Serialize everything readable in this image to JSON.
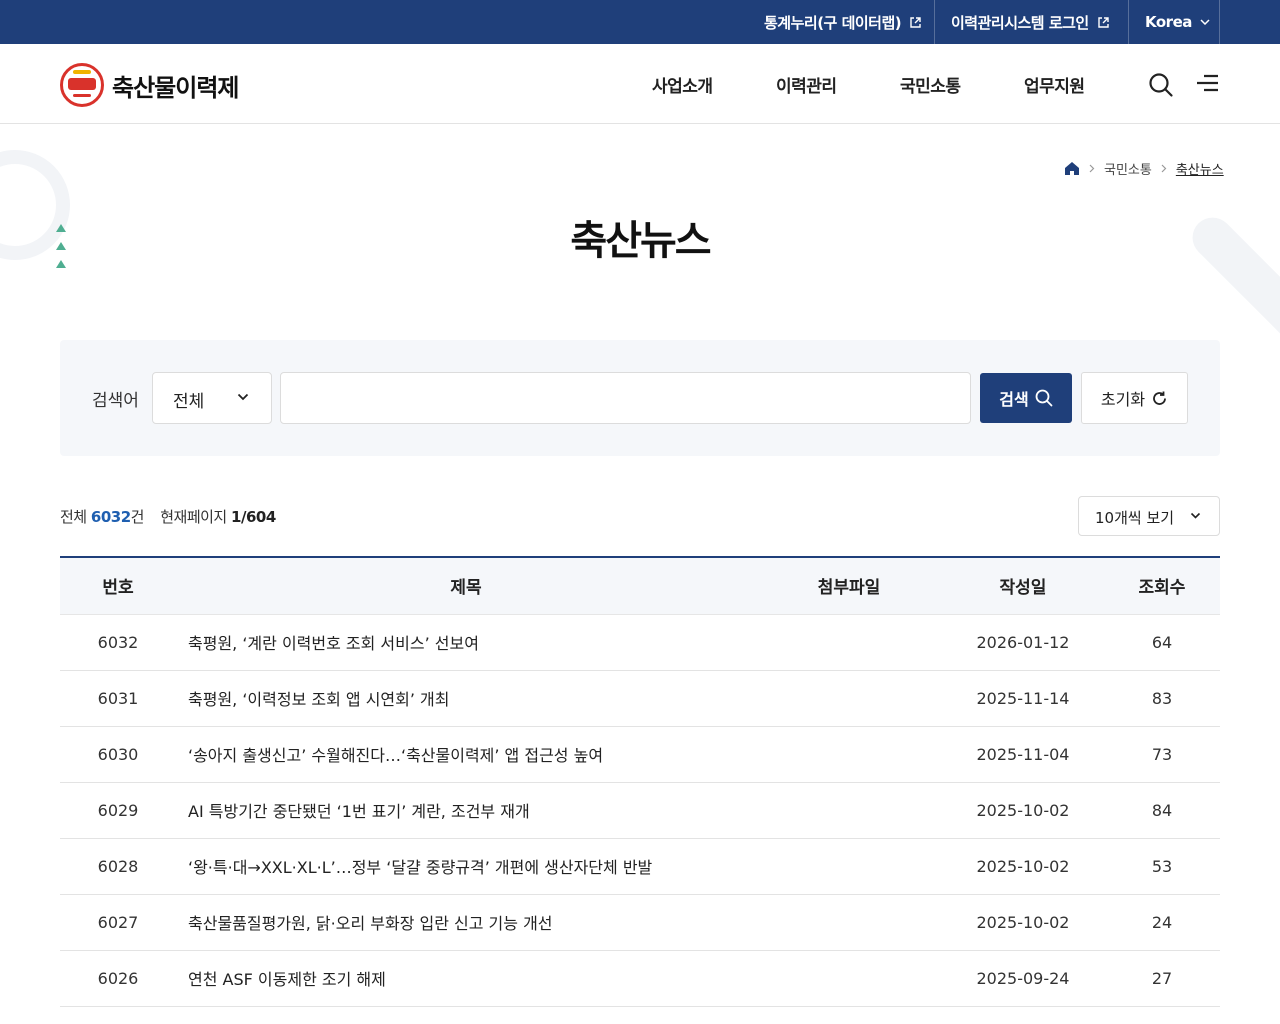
{
  "topbar": {
    "stats_link": "통계누리(구 데이터랩)",
    "login_link": "이력관리시스템 로그인",
    "language": "Korea"
  },
  "header": {
    "brand": "축산물이력제",
    "nav": [
      "사업소개",
      "이력관리",
      "국민소통",
      "업무지원"
    ],
    "icons": [
      "search-icon",
      "menu-icon"
    ]
  },
  "breadcrumb": {
    "home_icon": "home-icon",
    "items": [
      "국민소통",
      "축산뉴스"
    ]
  },
  "page_title": "축산뉴스",
  "search": {
    "label": "검색어",
    "category_selected": "전체",
    "query_value": "",
    "search_button": "검색",
    "reset_button": "초기화"
  },
  "summary": {
    "total_label": "전체",
    "total_count": "6032",
    "total_unit": "건",
    "page_label": "현재페이지",
    "page_value": "1/604",
    "per_page": "10개씩 보기"
  },
  "table": {
    "headers": [
      "번호",
      "제목",
      "첨부파일",
      "작성일",
      "조회수"
    ],
    "rows": [
      {
        "no": "6032",
        "title": "축평원, ‘계란 이력번호 조회 서비스’ 선보여",
        "file": "",
        "date": "2026-01-12",
        "views": "64"
      },
      {
        "no": "6031",
        "title": "축평원, ‘이력정보 조회 앱 시연회’ 개최",
        "file": "",
        "date": "2025-11-14",
        "views": "83"
      },
      {
        "no": "6030",
        "title": "‘송아지 출생신고’ 수월해진다…‘축산물이력제’ 앱 접근성 높여",
        "file": "",
        "date": "2025-11-04",
        "views": "73"
      },
      {
        "no": "6029",
        "title": "AI 특방기간 중단됐던 ‘1번 표기’ 계란, 조건부 재개",
        "file": "",
        "date": "2025-10-02",
        "views": "84"
      },
      {
        "no": "6028",
        "title": "‘왕·특·대→XXL·XL·L’…정부 ‘달걀 중량규격’ 개편에 생산자단체 반발",
        "file": "",
        "date": "2025-10-02",
        "views": "53"
      },
      {
        "no": "6027",
        "title": "축산물품질평가원, 닭·오리 부화장 입란 신고 기능 개선",
        "file": "",
        "date": "2025-10-02",
        "views": "24"
      },
      {
        "no": "6026",
        "title": "연천 ASF 이동제한 조기 해제",
        "file": "",
        "date": "2025-09-24",
        "views": "27"
      }
    ]
  },
  "colors": {
    "primary": "#1f3f7a",
    "count_accent": "#1f5fb0",
    "logo_red": "#d9322b",
    "deco_green": "#4fae91"
  }
}
